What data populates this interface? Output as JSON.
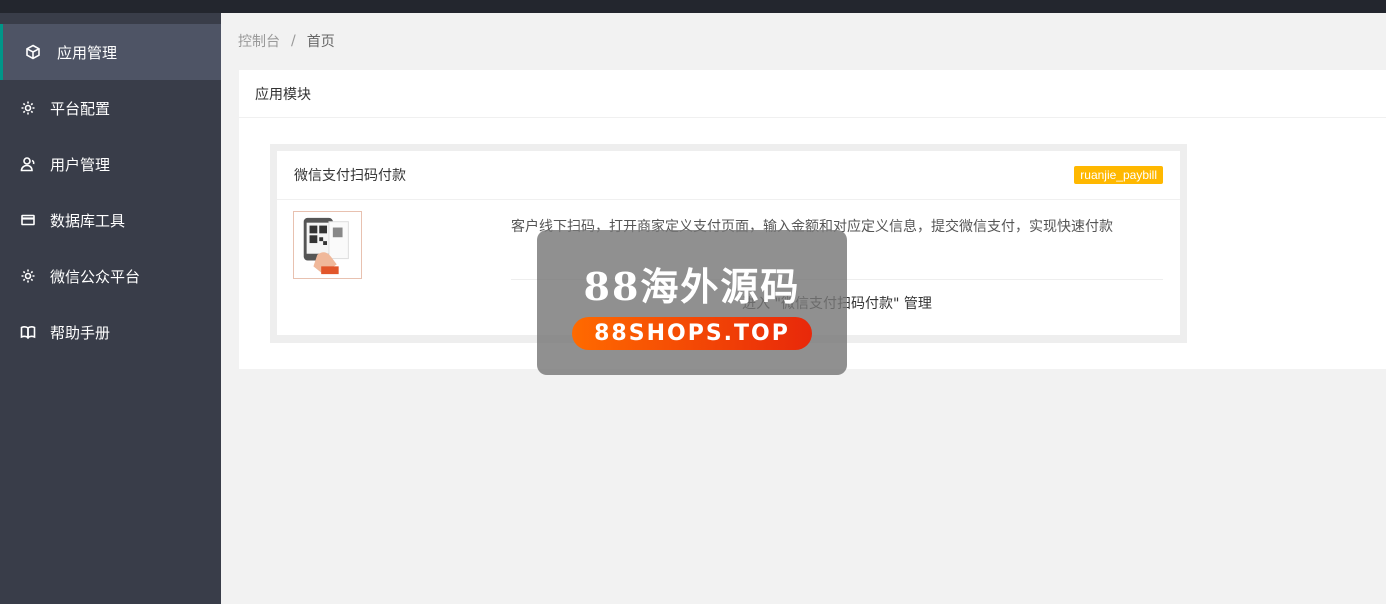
{
  "sidebar": {
    "items": [
      {
        "label": "应用管理",
        "icon": "cube-icon",
        "active": true
      },
      {
        "label": "平台配置",
        "icon": "gear-icon",
        "active": false
      },
      {
        "label": "用户管理",
        "icon": "user-icon",
        "active": false
      },
      {
        "label": "数据库工具",
        "icon": "window-icon",
        "active": false
      },
      {
        "label": "微信公众平台",
        "icon": "gear-icon",
        "active": false
      },
      {
        "label": "帮助手册",
        "icon": "book-icon",
        "active": false
      }
    ]
  },
  "breadcrumb": {
    "root": "控制台",
    "separator": "/",
    "current": "首页"
  },
  "panel": {
    "title": "应用模块"
  },
  "module": {
    "title": "微信支付扫码付款",
    "badge": "ruanjie_paybill",
    "description": "客户线下扫码，打开商家定义支付页面，输入金额和对应定义信息，提交微信支付，实现快速付款",
    "enter_link": "进入 \"微信支付扫码付款\" 管理"
  },
  "watermark": {
    "title": "88海外源码",
    "url": "88SHOPS.TOP"
  },
  "colors": {
    "sidebar_bg": "#393d49",
    "active_accent": "#009688",
    "badge_bg": "#ffb800"
  }
}
